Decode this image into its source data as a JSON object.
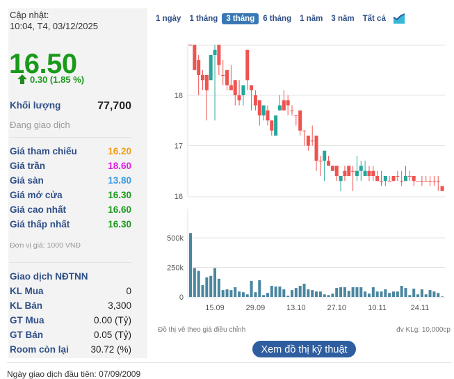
{
  "summary": {
    "update_label": "Cập nhật:",
    "update_time": "10:04, T4, 03/12/2025",
    "price": "16.50",
    "change": "0.30 (1.85 %)",
    "volume_label": "Khối lượng",
    "volume": "77,700",
    "status": "Đang giao dịch"
  },
  "prices": [
    {
      "label": "Giá tham chiếu",
      "value": "16.20",
      "color": "#f39c12"
    },
    {
      "label": "Giá trần",
      "value": "18.60",
      "color": "#e01ee0"
    },
    {
      "label": "Giá sàn",
      "value": "13.80",
      "color": "#3a9ae0"
    },
    {
      "label": "Giá mở cửa",
      "value": "16.30",
      "color": "#1a9a1a"
    },
    {
      "label": "Giá cao nhất",
      "value": "16.60",
      "color": "#1a9a1a"
    },
    {
      "label": "Giá thấp nhất",
      "value": "16.30",
      "color": "#1a9a1a"
    }
  ],
  "unit_note": "Đơn vị giá: 1000 VNĐ",
  "foreign": {
    "title": "Giao dịch NĐTNN",
    "rows": [
      {
        "label": "KL Mua",
        "value": "0"
      },
      {
        "label": "KL Bán",
        "value": "3,300"
      },
      {
        "label": "GT Mua",
        "value": "0.00 (Tỷ)"
      },
      {
        "label": "GT Bán",
        "value": "0.05 (Tỷ)"
      },
      {
        "label": "Room còn lại",
        "value": "30.72 (%)"
      }
    ]
  },
  "tabs": [
    {
      "label": "1 ngày",
      "active": false
    },
    {
      "label": "1 tháng",
      "active": false
    },
    {
      "label": "3 tháng",
      "active": true
    },
    {
      "label": "6 tháng",
      "active": false
    },
    {
      "label": "1 năm",
      "active": false
    },
    {
      "label": "3 năm",
      "active": false
    },
    {
      "label": "Tất cả",
      "active": false
    }
  ],
  "chart_icon": "area-chart-icon",
  "chart_data": [
    {
      "type": "candlestick",
      "ylim": [
        16,
        19
      ],
      "y_ticks": [
        "16",
        "17",
        "18"
      ],
      "colors": {
        "up": "#26a69a",
        "down": "#ef5350"
      },
      "ohlc": [
        [
          19,
          19,
          19,
          19
        ],
        [
          19,
          19,
          18.5,
          18.5
        ],
        [
          18.7,
          18.8,
          18,
          18.4
        ],
        [
          18.4,
          18.5,
          18.1,
          18.3
        ],
        [
          18.4,
          18.4,
          17.5,
          18.1
        ],
        [
          18.3,
          18.8,
          18.3,
          18.8
        ],
        [
          18.8,
          19,
          17.5,
          18.9
        ],
        [
          19,
          19,
          18.4,
          18.6
        ],
        [
          18.4,
          18.7,
          18.2,
          18.4
        ],
        [
          18.5,
          18.5,
          18.1,
          18.2
        ],
        [
          18.2,
          18.6,
          18.1,
          18.1
        ],
        [
          18.3,
          18.3,
          17.8,
          18
        ],
        [
          18,
          18.3,
          17.8,
          17.9
        ],
        [
          18,
          18.2,
          17.8,
          18.2
        ],
        [
          18.9,
          18.9,
          18.1,
          18.3
        ],
        [
          18.2,
          18.2,
          17.7,
          18.1
        ],
        [
          18,
          18.1,
          17.7,
          17.8
        ],
        [
          17.9,
          17.9,
          17.4,
          17.6
        ],
        [
          17.6,
          17.8,
          17.5,
          17.8
        ],
        [
          17.7,
          17.8,
          17.4,
          17.5
        ],
        [
          17.5,
          17.5,
          17.2,
          17.3
        ],
        [
          17.2,
          17.6,
          17.2,
          17.6
        ],
        [
          17.7,
          18,
          17.7,
          17.8
        ],
        [
          17.9,
          18.1,
          17.7,
          17.7
        ],
        [
          17.9,
          18,
          17.6,
          17.8
        ],
        [
          17.7,
          17.8,
          17.6,
          17.7
        ],
        [
          17.6,
          17.6,
          17.4,
          17.6
        ],
        [
          17.7,
          17.7,
          17.2,
          17.3
        ],
        [
          17.3,
          17.3,
          17,
          17.3
        ],
        [
          17.2,
          17.2,
          16.9,
          17
        ],
        [
          17.1,
          17.4,
          17,
          17.1
        ],
        [
          17.2,
          17.2,
          16.5,
          16.7
        ],
        [
          16.7,
          16.8,
          16.4,
          16.7
        ],
        [
          16.7,
          16.9,
          16.3,
          16.9
        ],
        [
          16.7,
          16.8,
          16.6,
          16.6
        ],
        [
          16.6,
          16.6,
          16.5,
          16.5
        ],
        [
          16.6,
          16.6,
          16.3,
          16.4
        ],
        [
          16.3,
          16.4,
          16.1,
          16.4
        ],
        [
          16.5,
          16.6,
          16.3,
          16.4
        ],
        [
          16.6,
          16.6,
          16.4,
          16.4
        ],
        [
          16.5,
          16.6,
          16.1,
          16.5
        ],
        [
          16.4,
          16.8,
          16.3,
          16.5
        ],
        [
          16.5,
          16.7,
          16.3,
          16.6
        ],
        [
          16.4,
          16.7,
          16.4,
          16.5
        ],
        [
          16.5,
          16.6,
          16.3,
          16.4
        ],
        [
          16.5,
          16.6,
          16.3,
          16.4
        ],
        [
          16.4,
          16.5,
          16.3,
          16.3
        ],
        [
          16.3,
          16.5,
          16.2,
          16.3
        ],
        [
          16.3,
          16.4,
          16.2,
          16.4
        ],
        [
          16.3,
          16.4,
          16.3,
          16.3
        ],
        [
          16.4,
          16.4,
          16.3,
          16.3
        ],
        [
          16.4,
          16.5,
          16.3,
          16.4
        ],
        [
          16.3,
          16.5,
          16.2,
          16.3
        ],
        [
          16.3,
          16.6,
          16.3,
          16.4
        ],
        [
          16.4,
          16.5,
          16.3,
          16.4
        ],
        [
          16.4,
          16.4,
          16.2,
          16.3
        ],
        [
          16.3,
          16.3,
          16.3,
          16.3
        ],
        [
          16.3,
          16.4,
          16.2,
          16.3
        ],
        [
          16.3,
          16.4,
          16.3,
          16.3
        ],
        [
          16.3,
          16.4,
          16.2,
          16.3
        ],
        [
          16.3,
          16.4,
          16.2,
          16.3
        ],
        [
          16.3,
          16.4,
          16.1,
          16.3
        ],
        [
          16.2,
          16.2,
          16.1,
          16.1
        ]
      ]
    },
    {
      "type": "bar",
      "ylim": [
        0,
        600000
      ],
      "y_ticks": [
        "0",
        "250k",
        "500k"
      ],
      "x_tick_labels": [
        "15.09",
        "29.09",
        "13.10",
        "27.10",
        "10.11",
        "24.11"
      ],
      "color": "#4a86a0",
      "values": [
        540000,
        244000,
        220000,
        100000,
        166000,
        178000,
        244000,
        154000,
        58000,
        64000,
        58000,
        82000,
        46000,
        40000,
        22000,
        136000,
        40000,
        142000,
        16000,
        34000,
        94000,
        88000,
        88000,
        64000,
        10000,
        58000,
        76000,
        94000,
        112000,
        64000,
        58000,
        46000,
        46000,
        22000,
        16000,
        28000,
        76000,
        82000,
        82000,
        52000,
        82000,
        82000,
        82000,
        46000,
        28000,
        82000,
        46000,
        46000,
        64000,
        34000,
        46000,
        46000,
        94000,
        76000,
        16000,
        70000,
        22000,
        64000,
        22000,
        58000,
        46000,
        34000,
        4000
      ]
    }
  ],
  "notes": {
    "adjusted": "Đồ thị vẽ theo giá điều chỉnh",
    "unit": "đv KLg: 10,000cp"
  },
  "tech_button": "Xem đồ thị kỹ thuật",
  "footer": "Ngày giao dịch đầu tiên: 07/09/2009"
}
